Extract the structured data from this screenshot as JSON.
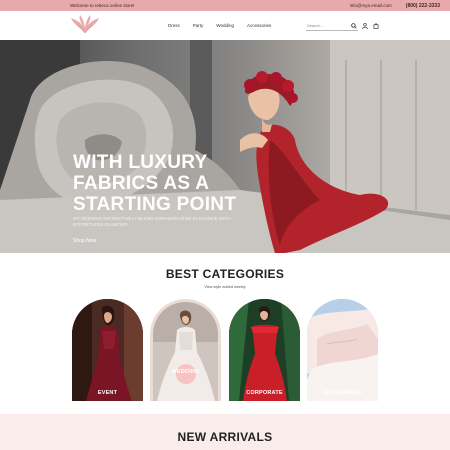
{
  "topbar": {
    "welcome": "Welcome to rebeca online store!",
    "email": "info@rsya.email.com",
    "phone": "(800) 222-3333"
  },
  "nav": {
    "items": [
      "Dress",
      "Party",
      "Wedding",
      "Accessories"
    ]
  },
  "search": {
    "placeholder": "Search..."
  },
  "hero": {
    "title_lines": [
      "WITH LUXURY",
      "FABRICS AS A",
      "STARTING POINT"
    ],
    "subtitle": "MY DESIGNS INSTINCTIVELY BLEND SOPHISTICATED ELEGANCE WITH EFFORTLESS GLAMOUR",
    "cta": "Shop Now"
  },
  "categories": {
    "title": "BEST CATEGORIES",
    "subtitle": "View style added weekly",
    "items": [
      {
        "label": "EVENT"
      },
      {
        "label": "WEDDING"
      },
      {
        "label": "CORPORATE"
      },
      {
        "label": "ACCEORIESS"
      }
    ]
  },
  "arrivals": {
    "title": "NEW ARRIVALS"
  },
  "colors": {
    "accent": "#e8a9ad",
    "dress_red": "#b3232b",
    "arrivals_bg": "#fbecec"
  }
}
